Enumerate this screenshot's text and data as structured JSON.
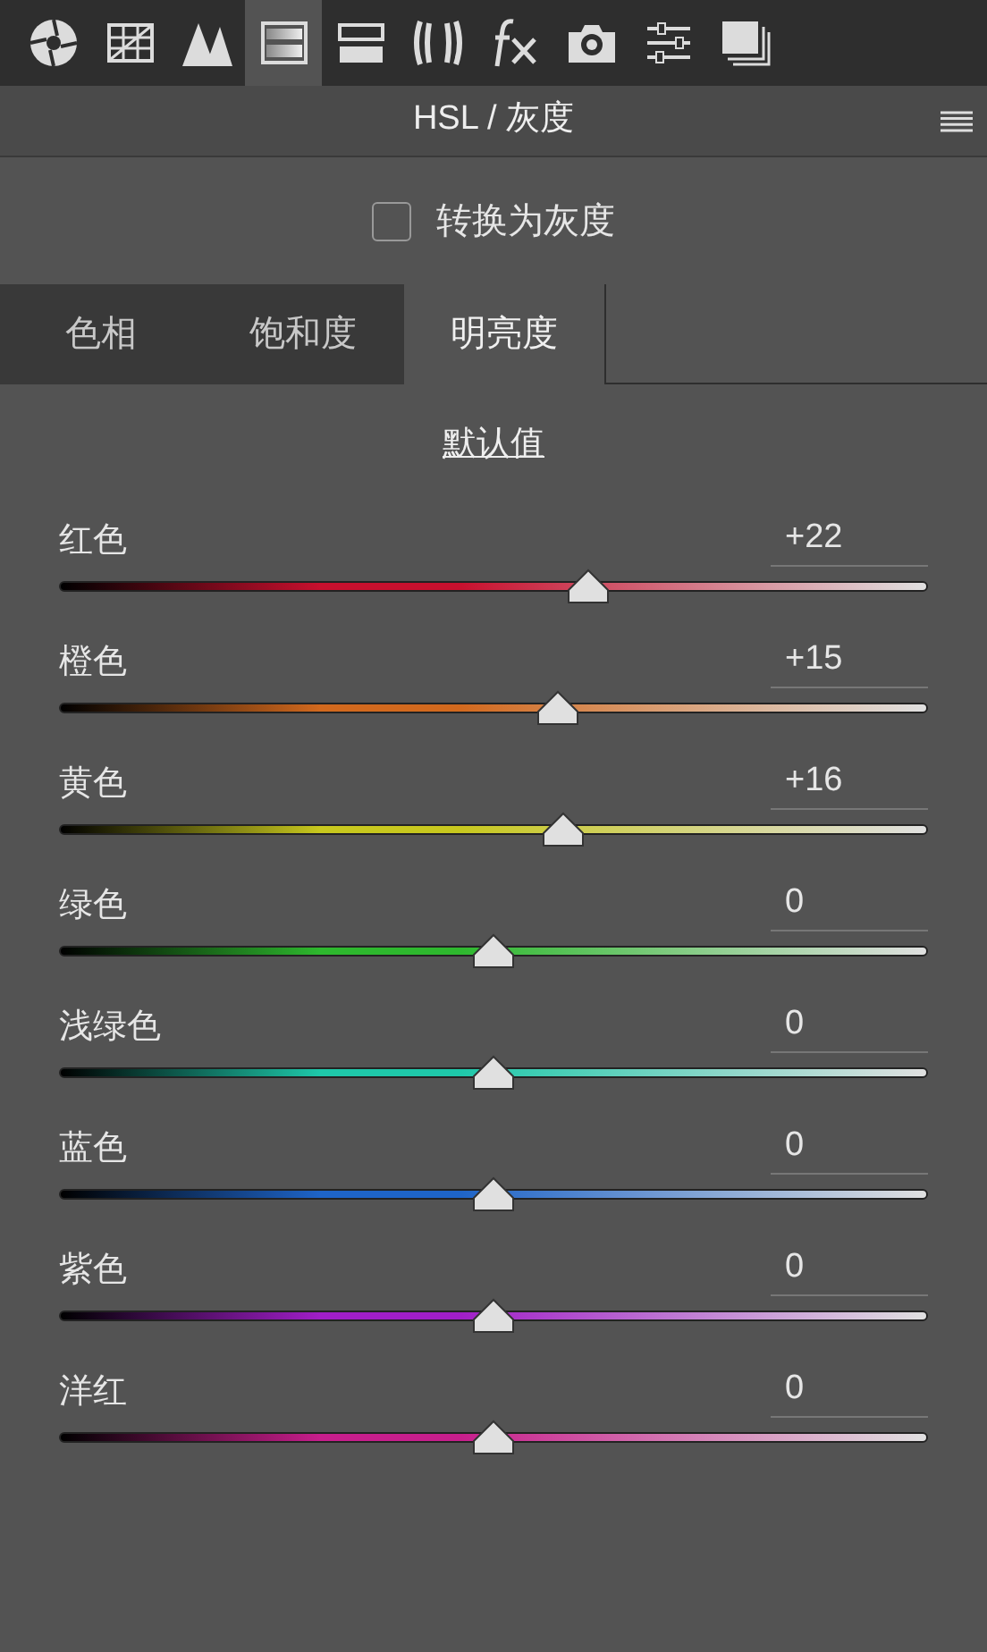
{
  "toolbar": [
    {
      "kind": "aperture",
      "selected": false
    },
    {
      "kind": "grid",
      "selected": false
    },
    {
      "kind": "mountains",
      "selected": false
    },
    {
      "kind": "gradient",
      "selected": true
    },
    {
      "kind": "split",
      "selected": false
    },
    {
      "kind": "lens",
      "selected": false
    },
    {
      "kind": "fx",
      "selected": false
    },
    {
      "kind": "camera",
      "selected": false
    },
    {
      "kind": "sliders",
      "selected": false
    },
    {
      "kind": "stack",
      "selected": false
    }
  ],
  "panel": {
    "title": "HSL / 灰度"
  },
  "grayscale": {
    "label": "转换为灰度",
    "checked": false
  },
  "tabs": [
    {
      "label": "色相",
      "selected": false
    },
    {
      "label": "饱和度",
      "selected": false
    },
    {
      "label": "明亮度",
      "selected": true
    }
  ],
  "default_link": "默认值",
  "channels": [
    {
      "name": "红色",
      "reading": "+22",
      "level": 0.61,
      "color": "#c8102e"
    },
    {
      "name": "橙色",
      "reading": "+15",
      "level": 0.575,
      "color": "#d2691e"
    },
    {
      "name": "黄色",
      "reading": "+16",
      "level": 0.58,
      "color": "#c8c81e"
    },
    {
      "name": "绿色",
      "reading": "0",
      "level": 0.5,
      "color": "#2eb82e"
    },
    {
      "name": "浅绿色",
      "reading": "0",
      "level": 0.5,
      "color": "#1ec8aa"
    },
    {
      "name": "蓝色",
      "reading": "0",
      "level": 0.5,
      "color": "#1e64c8"
    },
    {
      "name": "紫色",
      "reading": "0",
      "level": 0.5,
      "color": "#a01ec8"
    },
    {
      "name": "洋红",
      "reading": "0",
      "level": 0.5,
      "color": "#c81e8c"
    }
  ]
}
